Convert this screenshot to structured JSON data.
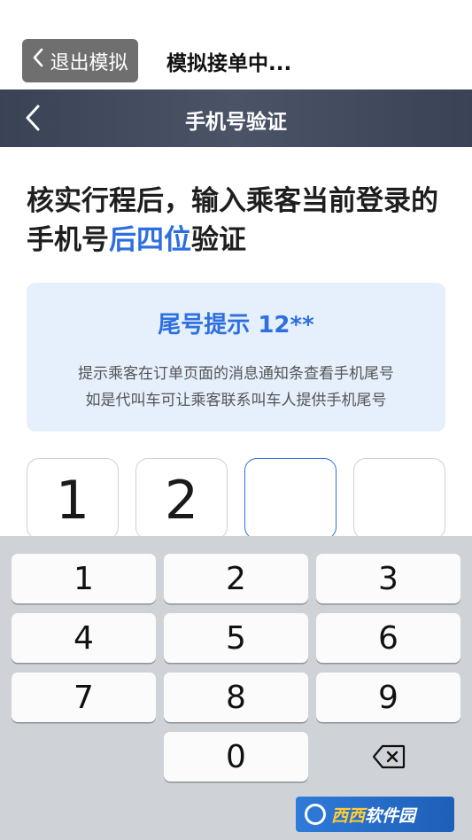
{
  "sim_bar": {
    "exit_label": "退出模拟",
    "status": "模拟接单中..."
  },
  "nav": {
    "title": "手机号验证"
  },
  "instruction": {
    "prefix": "核实行程后，输入乘客当前登录的手机号",
    "highlight": "后四位",
    "suffix": "验证"
  },
  "hint": {
    "title": "尾号提示  12**",
    "line1": "提示乘客在订单页面的消息通知条查看手机尾号",
    "line2": "如是代叫车可让乘客联系叫车人提供手机尾号"
  },
  "code": {
    "digits": [
      "1",
      "2",
      "",
      ""
    ]
  },
  "keypad": {
    "keys": [
      "1",
      "2",
      "3",
      "4",
      "5",
      "6",
      "7",
      "8",
      "9",
      "0"
    ]
  },
  "watermark": {
    "brand": "西西",
    "text": "软件园"
  },
  "colors": {
    "accent": "#2e6fe0",
    "nav_bg": "#3f4859",
    "hint_bg": "#e6effc",
    "keypad_bg": "#cfd3d8"
  }
}
